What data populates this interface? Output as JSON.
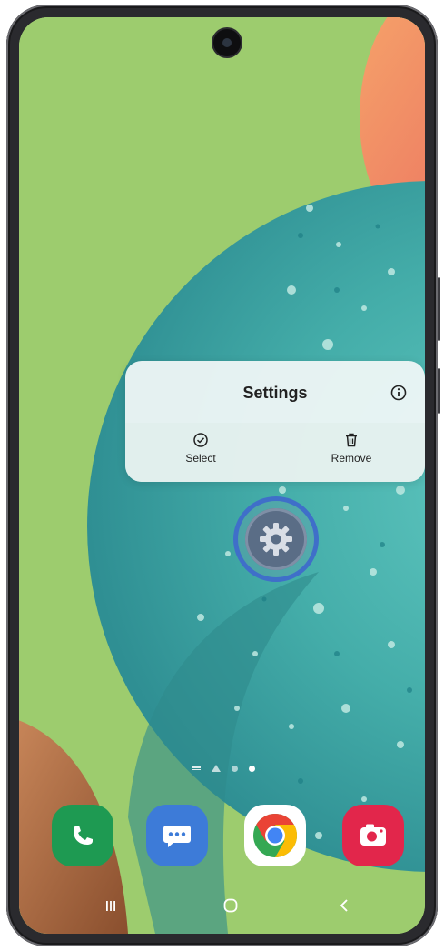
{
  "colors": {
    "wallpaper_green": "#9dcc6e",
    "phone_bezel": "#2a2a2e",
    "settings_highlight": "#3f6fc9",
    "phone_app": "#1e9a52",
    "messages_app": "#3d7bd8",
    "camera_app": "#e2264b",
    "popup_bg": "#f0f7f6"
  },
  "context_menu": {
    "title": "Settings",
    "info_icon": "info-icon",
    "actions": [
      {
        "label": "Select",
        "icon": "check-circle-icon"
      },
      {
        "label": "Remove",
        "icon": "trash-icon"
      }
    ]
  },
  "selected_app": {
    "icon": "gear-icon"
  },
  "pager": {
    "page_count": 3,
    "active_page": 3
  },
  "dock": {
    "apps": [
      {
        "icon": "phone-icon"
      },
      {
        "icon": "messages-icon"
      },
      {
        "icon": "chrome-icon"
      },
      {
        "icon": "camera-icon"
      }
    ]
  },
  "navigation": {
    "buttons": [
      {
        "icon": "recents-icon"
      },
      {
        "icon": "home-icon"
      },
      {
        "icon": "back-icon"
      }
    ]
  }
}
